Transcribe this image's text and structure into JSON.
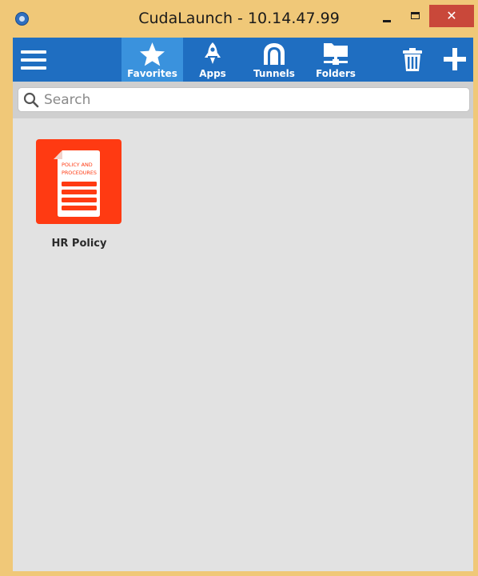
{
  "window": {
    "title": "CudaLaunch - 10.14.47.99",
    "close_glyph": "✕",
    "accent_close": "#c9483a",
    "frame_color": "#f0c878"
  },
  "toolbar": {
    "color": "#1f6ec1",
    "active_color": "#3a92dd",
    "tabs": [
      {
        "label": "Favorites",
        "icon": "star-icon",
        "active": true
      },
      {
        "label": "Apps",
        "icon": "rocket-icon",
        "active": false
      },
      {
        "label": "Tunnels",
        "icon": "tunnel-icon",
        "active": false
      },
      {
        "label": "Folders",
        "icon": "folder-network-icon",
        "active": false
      }
    ],
    "actions": [
      {
        "icon": "trash-icon"
      },
      {
        "icon": "plus-icon"
      }
    ]
  },
  "search": {
    "placeholder": "Search",
    "value": ""
  },
  "favorites": {
    "items": [
      {
        "label": "HR Policy",
        "icon": "policy-document-icon",
        "icon_text_line1": "POLICY AND",
        "icon_text_line2": "PROCEDURES",
        "color": "#ff3a12"
      }
    ]
  }
}
